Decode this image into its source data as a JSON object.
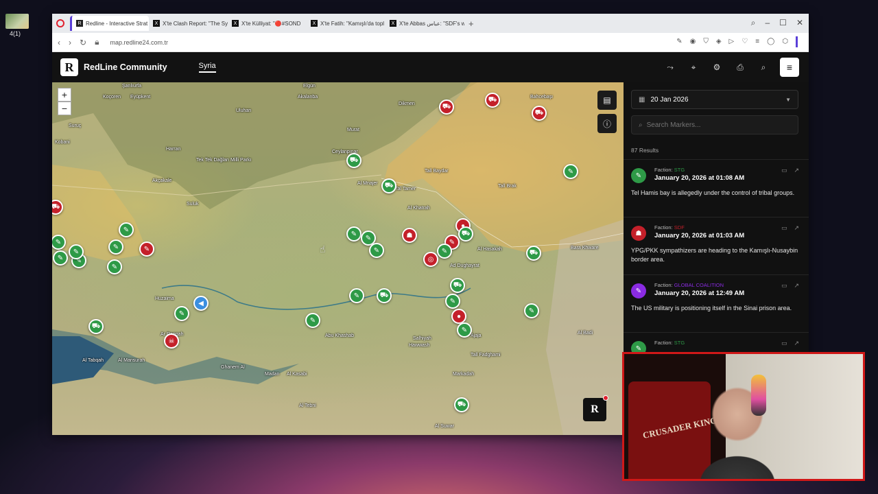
{
  "desktop": {
    "icon_label": "4(1)"
  },
  "browser": {
    "tabs": [
      {
        "label": "Redline - Interactive Strat",
        "favicon": "R",
        "active": true
      },
      {
        "label": "X'te Clash Report: \"The Sy",
        "favicon": "X",
        "active": false
      },
      {
        "label": "X'te Külliyat: \"🔴#SOND",
        "favicon": "X",
        "active": false
      },
      {
        "label": "X'te Fatih: \"Kamışlı'da topl",
        "favicon": "X",
        "active": false
      },
      {
        "label": "X'te Abbas عباس: \"SDF's w",
        "favicon": "X",
        "active": false
      }
    ],
    "new_tab": "+",
    "url": "map.redline24.com.tr"
  },
  "app": {
    "brand": "RedLine Community",
    "logo_letter": "R",
    "country": "Syria",
    "header_icons": [
      "route-icon",
      "location-pin-icon",
      "settings-icon",
      "camera-icon",
      "search-icon",
      "menu-icon"
    ]
  },
  "map": {
    "zoom_in": "+",
    "zoom_out": "−",
    "corner_logo": "R",
    "places": [
      "Şanlıurfa",
      "Koçoren",
      "Eyüpkent",
      "Suruç",
      "Kobani",
      "Harran",
      "Akçakale",
      "Tek Tek Dağları Milli Parkı",
      "Ceylanpınar",
      "Elgün",
      "Akalanba",
      "Uluhan",
      "Murat",
      "Dikmen",
      "Bahcebaşı",
      "Al Mnajer",
      "Tal Tamer",
      "Tall Baydar",
      "Tall Brak",
      "Al Khatrah",
      "Suluk",
      "Ad Dughayrat",
      "Al Hasakah",
      "Bara Khware",
      "Huzaima",
      "Ar Raqqah",
      "Abu Khashab",
      "Salhiyah",
      "Ghanem Al",
      "Al Tabqah",
      "Al Mansurah",
      "Madan",
      "Al Kasabi",
      "Al Tebni",
      "Markadah",
      "Tall Fadghami",
      "Al Suwar",
      "Al Badi",
      "Ajaja",
      "Hawwash"
    ]
  },
  "panel": {
    "date": "20 Jan 2026",
    "search_placeholder": "Search Markers...",
    "results": "87 Results",
    "items": [
      {
        "faction_label": "Faction:",
        "faction": "STG",
        "faction_color": "#2e9a47",
        "date": "January 20, 2026 at 01:08 AM",
        "text": "Tel Hamis bay is allegedly under the control of tribal groups.",
        "avatar_color": "#2e9a47",
        "icon": "rifle-icon"
      },
      {
        "faction_label": "Faction:",
        "faction": "SDF",
        "faction_color": "#c4202a",
        "date": "January 20, 2026 at 01:03 AM",
        "text": "YPG/PKK sympathizers are heading to the Kamışlı-Nusaybin border area.",
        "avatar_color": "#c4202a",
        "icon": "people-icon"
      },
      {
        "faction_label": "Faction:",
        "faction": "GLOBAL COALITION",
        "faction_color": "#8a2be2",
        "date": "January 20, 2026 at 12:49 AM",
        "text": "The US military is positioning itself in the Sinai prison area.",
        "avatar_color": "#8a2be2",
        "icon": "rifle-icon"
      },
      {
        "faction_label": "Faction:",
        "faction": "STG",
        "faction_color": "#2e9a47",
        "date": "",
        "text": "",
        "avatar_color": "#2e9a47",
        "icon": "rifle-icon"
      }
    ]
  },
  "webcam": {
    "chair_text": "CRUSADER KINGS"
  }
}
